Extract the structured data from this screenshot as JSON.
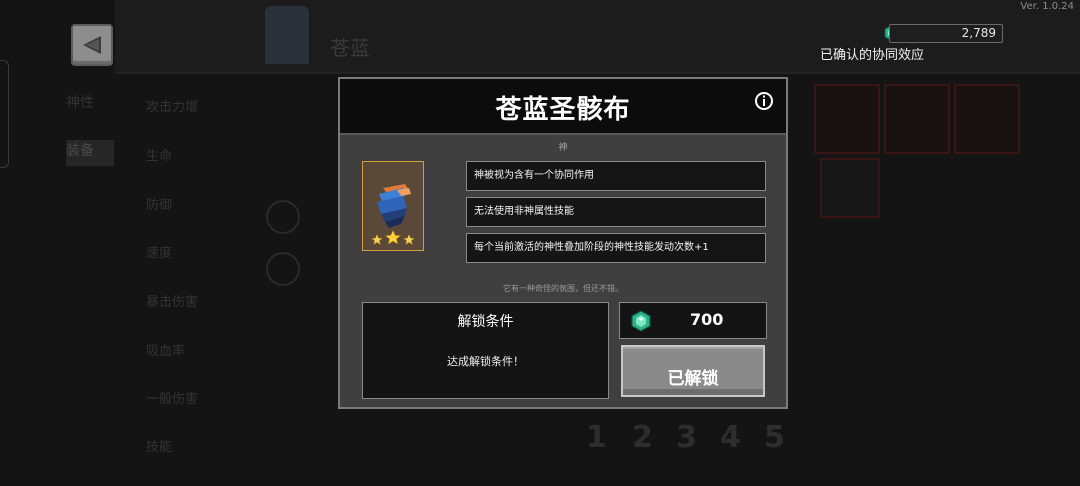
{
  "version": "Ver. 1.0.24",
  "currency": {
    "amount": "2,789",
    "icon": "gem-icon",
    "color": "#2bb38a"
  },
  "synergy_link": "已确认的协同效应",
  "background": {
    "dim_title": "苍蓝",
    "side_tabs": [
      "神性",
      "装备"
    ],
    "list_items": [
      "攻击力增",
      "生命",
      "防御",
      "速度",
      "暴击伤害",
      "吸血率",
      "一般伤害",
      "技能"
    ],
    "pager": [
      "1",
      "2",
      "3",
      "4",
      "5"
    ]
  },
  "modal": {
    "title": "苍蓝圣骸布",
    "category": "神",
    "item": {
      "icon": "shroud-icon",
      "stars": 3,
      "frame_color": "#d2a03a"
    },
    "effects": [
      "神被视为含有一个协同作用",
      "无法使用非神属性技能",
      "每个当前激活的神性叠加阶段的神性技能发动次数+1"
    ],
    "flavor": "它有一种奇怪的氛围，但还不错。",
    "unlock": {
      "title": "解锁条件",
      "description": "达成解锁条件！"
    },
    "price": {
      "value": "700",
      "icon": "gem-icon"
    },
    "status_button": "已解锁"
  }
}
